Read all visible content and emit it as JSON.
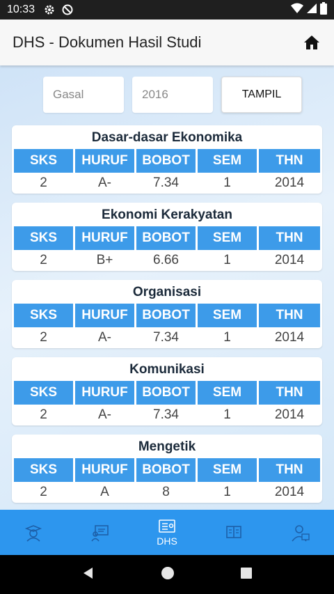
{
  "status_bar": {
    "time": "10:33"
  },
  "app_bar": {
    "title": "DHS - Dokumen Hasil Studi"
  },
  "filters": {
    "semester": "Gasal",
    "year": "2016",
    "button": "TAMPIL"
  },
  "table_headers": [
    "SKS",
    "HURUF",
    "BOBOT",
    "SEM",
    "THN"
  ],
  "courses": [
    {
      "name": "Dasar-dasar Ekonomika",
      "values": [
        "2",
        "A-",
        "7.34",
        "1",
        "2014"
      ]
    },
    {
      "name": "Ekonomi Kerakyatan",
      "values": [
        "2",
        "B+",
        "6.66",
        "1",
        "2014"
      ]
    },
    {
      "name": "Organisasi",
      "values": [
        "2",
        "A-",
        "7.34",
        "1",
        "2014"
      ]
    },
    {
      "name": "Komunikasi",
      "values": [
        "2",
        "A-",
        "7.34",
        "1",
        "2014"
      ]
    },
    {
      "name": "Mengetik",
      "values": [
        "2",
        "A",
        "8",
        "1",
        "2014"
      ]
    }
  ],
  "bottom_nav": {
    "active_label": "DHS"
  }
}
